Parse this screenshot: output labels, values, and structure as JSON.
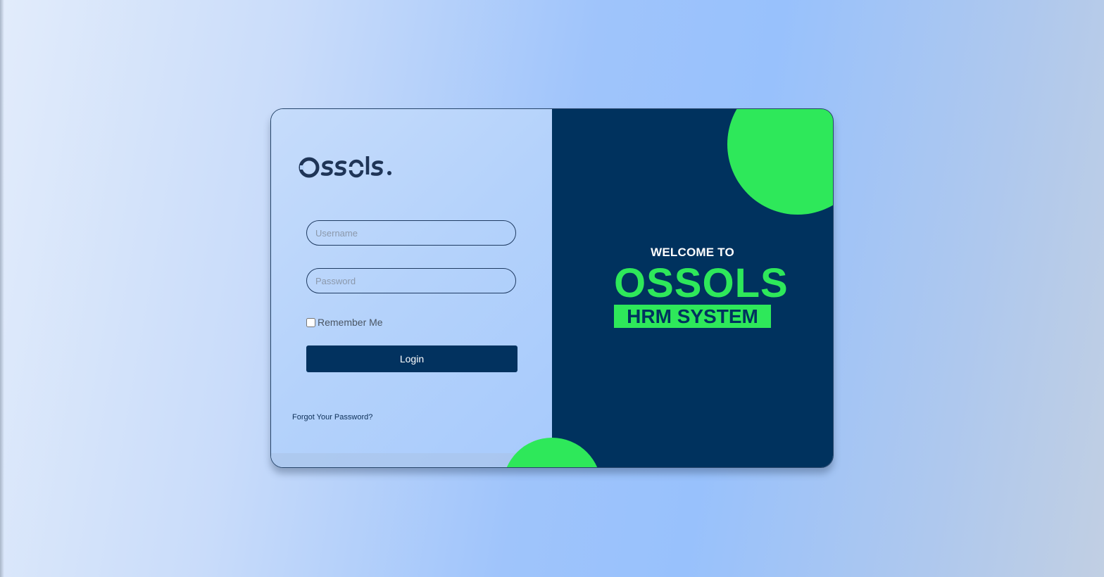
{
  "logo": {
    "text": "Ossols."
  },
  "login_form": {
    "username_placeholder": "Username",
    "password_placeholder": "Password",
    "remember_label": "Remember Me",
    "login_label": "Login",
    "forgot_label": "Forgot Your Password?"
  },
  "welcome": {
    "intro": "WELCOME TO",
    "brand": "OSSOLS",
    "tagline": "HRM SYSTEM"
  },
  "colors": {
    "navy": "#00325e",
    "green": "#2ee85a",
    "light_blue": "#b4d2fb"
  }
}
